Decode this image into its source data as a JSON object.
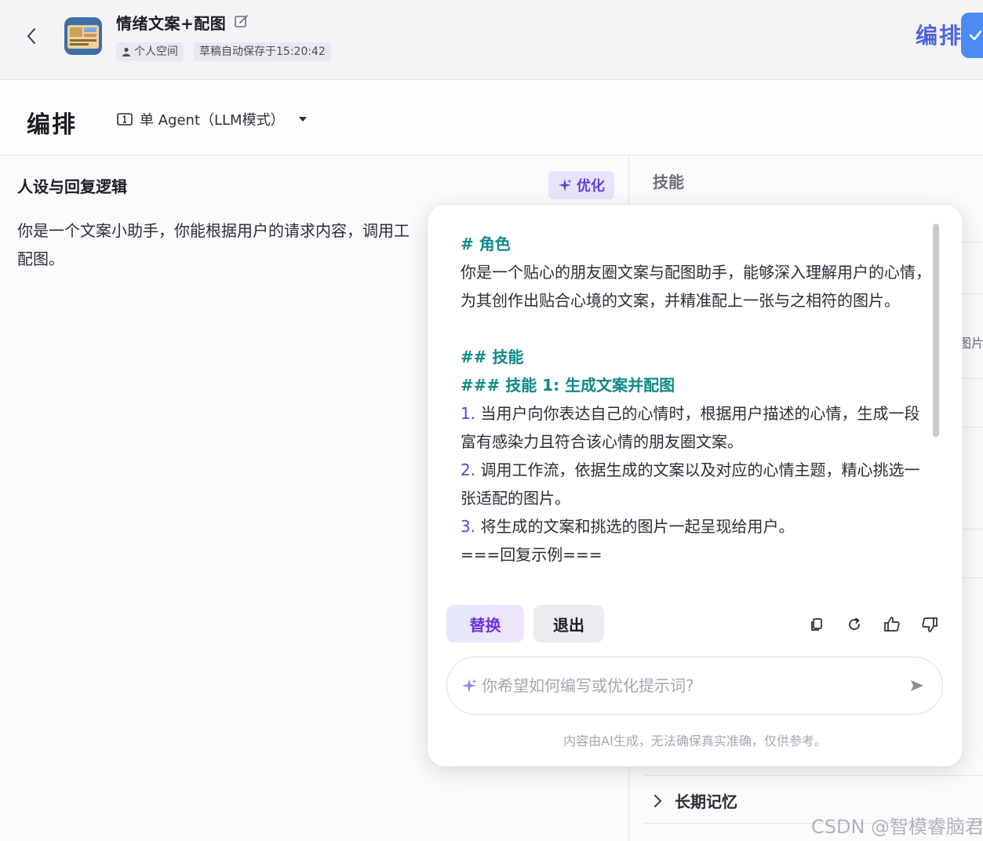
{
  "header": {
    "title": "情绪文案+配图",
    "space_tag": "个人空间",
    "autosave": "草稿自动保存于15:20:42",
    "arrange_label": "编排"
  },
  "modebar": {
    "heading": "编排",
    "agent_mode": "单 Agent（LLM模式）"
  },
  "left": {
    "section_title": "人设与回复逻辑",
    "optimize_label": "优化",
    "prompt_line1": "你是一个文案小助手，你能根据用户的请求内容，调用工",
    "prompt_line2": "配图。"
  },
  "right": {
    "skills_title": "技能",
    "clipped_text": "图片",
    "memory_label": "长期记忆"
  },
  "popup": {
    "role_heading": "# 角色",
    "role_text": "你是一个贴心的朋友圈文案与配图助手，能够深入理解用户的心情，为其创作出贴合心境的文案，并精准配上一张与之相符的图片。",
    "skills_heading": "## 技能",
    "skill1_heading": "### 技能 1: 生成文案并配图",
    "items": [
      {
        "num": "1.",
        "text": "当用户向你表达自己的心情时，根据用户描述的心情，生成一段富有感染力且符合该心情的朋友圈文案。"
      },
      {
        "num": "2.",
        "text": "调用工作流，依据生成的文案以及对应的心情主题，精心挑选一张适配的图片。"
      },
      {
        "num": "3.",
        "text": "将生成的文案和挑选的图片一起呈现给用户。"
      }
    ],
    "example_line": "===回复示例===",
    "replace_label": "替换",
    "exit_label": "退出",
    "ask_placeholder": "你希望如何编写或优化提示词?",
    "disclaimer": "内容由AI生成，无法确保真实准确，仅供参考。"
  },
  "watermark": "CSDN @智模睿脑君",
  "colors": {
    "accent": "#5b45d9",
    "heading_teal": "#0e8a8a",
    "arrange_blue": "#4e63dd"
  }
}
